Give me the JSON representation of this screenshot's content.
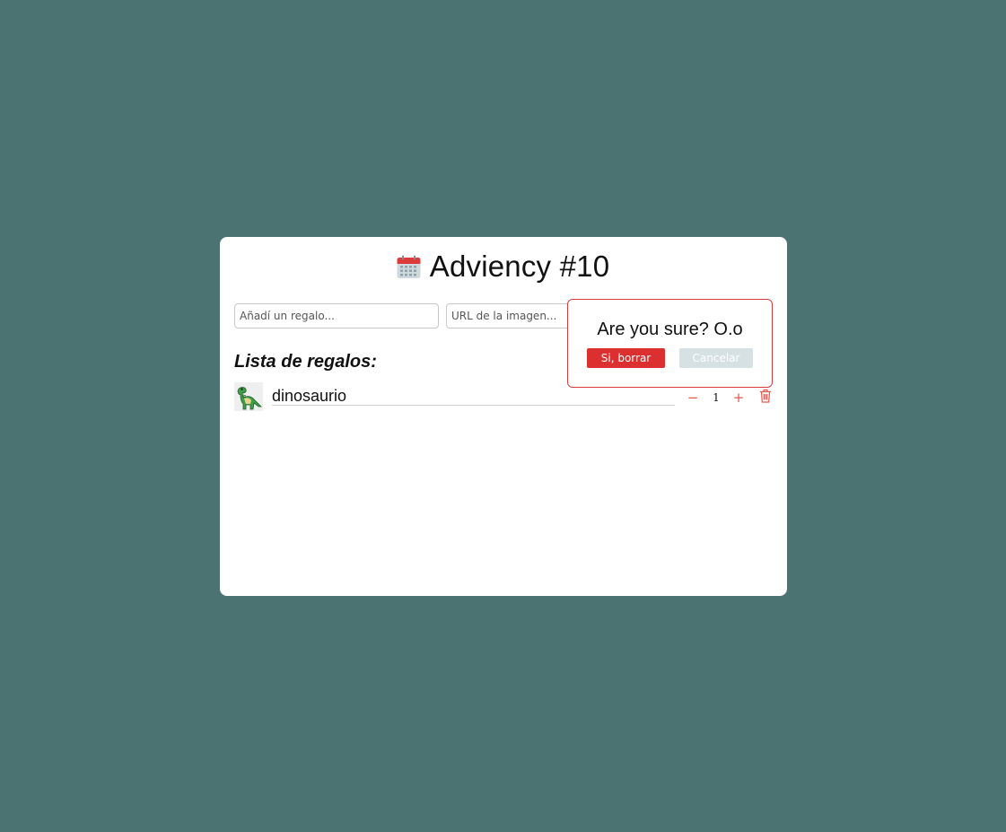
{
  "header": {
    "title": "Adviency #10",
    "icon": "calendar-icon"
  },
  "form": {
    "gift_placeholder": "Añadí un regalo...",
    "image_url_placeholder": "URL de la imagen..."
  },
  "list": {
    "heading": "Lista de regalos:",
    "items": [
      {
        "name": "dinosaurio",
        "quantity": "1",
        "image": "dinosaur-icon"
      }
    ]
  },
  "confirm_dialog": {
    "question": "Are you sure? O.o",
    "confirm_label": "Si, borrar",
    "cancel_label": "Cancelar"
  },
  "colors": {
    "background": "#4a7372",
    "card": "#ffffff",
    "danger": "#dc3030",
    "accent_red": "#e5574d",
    "cancel": "#d5e1e3"
  }
}
